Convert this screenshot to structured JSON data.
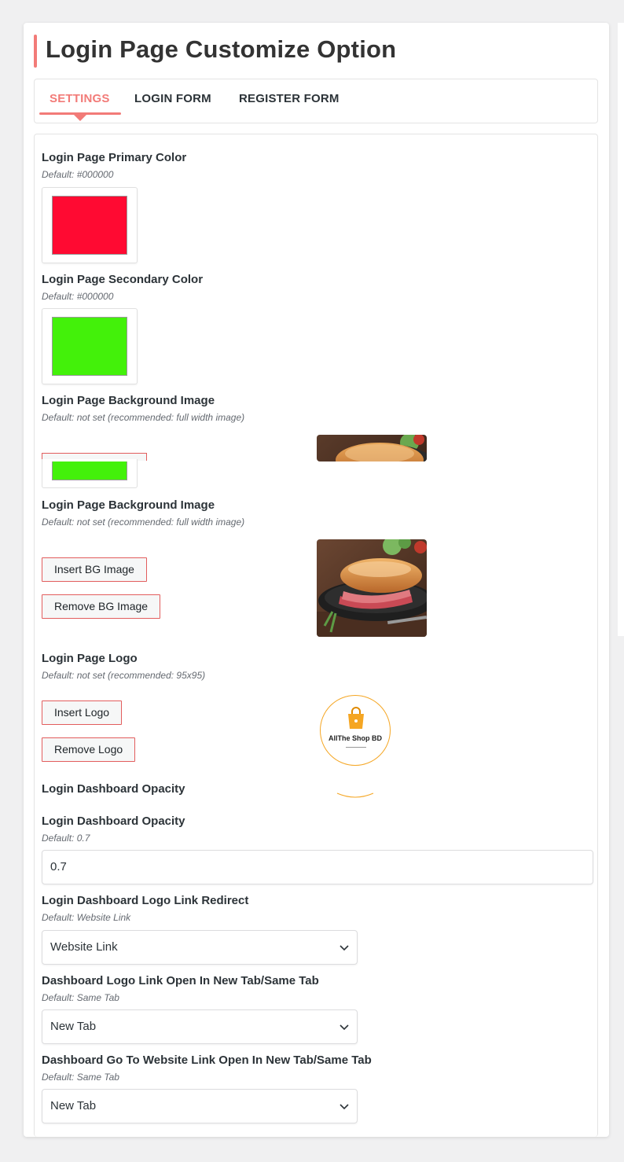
{
  "page": {
    "title": "Login Page Customize Option"
  },
  "tabs": [
    {
      "label": "SETTINGS",
      "active": true
    },
    {
      "label": "LOGIN FORM",
      "active": false
    },
    {
      "label": "REGISTER FORM",
      "active": false
    }
  ],
  "colors": {
    "accent": "#f27b78",
    "primary_swatch": "#ff0a32",
    "secondary_swatch": "#43f10a",
    "button_border": "#e25d5d"
  },
  "primary_color": {
    "label": "Login Page Primary Color",
    "hint": "Default: #000000",
    "value": "#ff0a32"
  },
  "secondary_color": {
    "label": "Login Page Secondary Color",
    "hint": "Default: #000000",
    "value": "#43f10a"
  },
  "bg_image_ghost": {
    "label": "Login Page Background Image",
    "hint": "Default: not set (recommended: full width image)"
  },
  "bg_image": {
    "label": "Login Page Background Image",
    "hint": "Default: not set (recommended: full width image)",
    "insert_label": "Insert BG Image",
    "remove_label": "Remove BG Image"
  },
  "logo": {
    "label": "Login Page Logo",
    "hint": "Default: not set (recommended: 95x95)",
    "insert_label": "Insert Logo",
    "remove_label": "Remove Logo",
    "logo_text": "AllThe Shop BD"
  },
  "opacity_ghost": {
    "label": "Login Dashboard Opacity"
  },
  "opacity": {
    "label": "Login Dashboard Opacity",
    "hint": "Default: 0.7",
    "value": "0.7"
  },
  "logo_link": {
    "label": "Login Dashboard Logo Link Redirect",
    "hint": "Default: Website Link",
    "value": "Website Link"
  },
  "logo_link_tab": {
    "label": "Dashboard Logo Link Open In New Tab/Same Tab",
    "hint": "Default: Same Tab",
    "value": "New Tab"
  },
  "website_link_tab": {
    "label": "Dashboard Go To Website Link Open In New Tab/Same Tab",
    "hint": "Default: Same Tab",
    "value": "New Tab"
  }
}
